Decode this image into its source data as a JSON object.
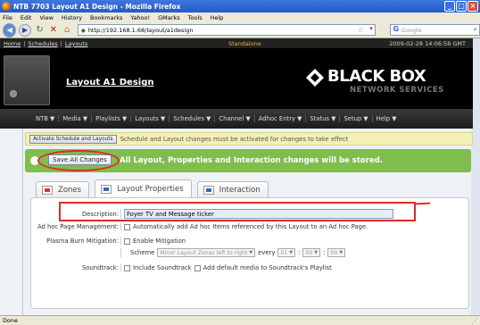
{
  "window": {
    "title": "NTB 7703 Layout A1 Design - Mozilla Firefox",
    "minimize_glyph": "_",
    "maximize_glyph": "□",
    "close_glyph": "×"
  },
  "menu": [
    "File",
    "Edit",
    "View",
    "History",
    "Bookmarks",
    "Yahoo!",
    "GMarks",
    "Tools",
    "Help"
  ],
  "toolbar": {
    "url": "http://192.168.1.68/layout/a1design",
    "search_placeholder": "Google"
  },
  "infostrip": {
    "breadcrumbs": [
      "Home",
      "Schedules",
      "Layouts"
    ],
    "mode": "Standalone",
    "datetime": "2009-02-28 14:06:58 GMT"
  },
  "banner": {
    "page_title": "Layout A1 Design",
    "logo_text": "BLACK BOX",
    "logo_sub": "NETWORK SERVICES"
  },
  "nav": [
    "NTB ▼",
    "Media ▼",
    "Playlists ▼",
    "Layouts ▼",
    "Schedules ▼",
    "Channel ▼",
    "Adhoc Entry ▼",
    "Status ▼",
    "Setup ▼",
    "Help ▼"
  ],
  "activate": {
    "button": "Activate Schedule and Layouts",
    "message": "Schedule and Layout changes must be activated for changes to take effect"
  },
  "save": {
    "button": "Save All Changes",
    "message": "All Layout, Properties and Interaction changes will be stored."
  },
  "tabs": [
    "Zones",
    "Layout Properties",
    "Interaction"
  ],
  "form": {
    "description_label": "Description:",
    "description_value": "Foyer TV and Message ticker",
    "adhoc_label": "Ad hoc Page Management:",
    "adhoc_text": "Automatically add Ad hoc Items referenced by this Layout to an Ad hoc Page.",
    "plasma_label": "Plasma Burn Mitigation:",
    "enable_mitigation": "Enable Mitigation",
    "scheme_label": "Scheme",
    "scheme_value": "Minor Layout Zones left to right",
    "every_label": "every",
    "every_hours": "01",
    "every_minutes": "00",
    "every_seconds": "00",
    "time_sep": ":",
    "soundtrack_label": "Soundtrack:",
    "include_soundtrack": "Include Soundtrack",
    "add_default_media": "Add default media to Soundtrack's Playlist"
  },
  "status": {
    "text": "Done"
  },
  "colors": {
    "title_bar": "#2358c8",
    "green_bar": "#7fbd4e",
    "annotation_red": "#e02a24",
    "activate_bar": "#f3f0b6"
  }
}
